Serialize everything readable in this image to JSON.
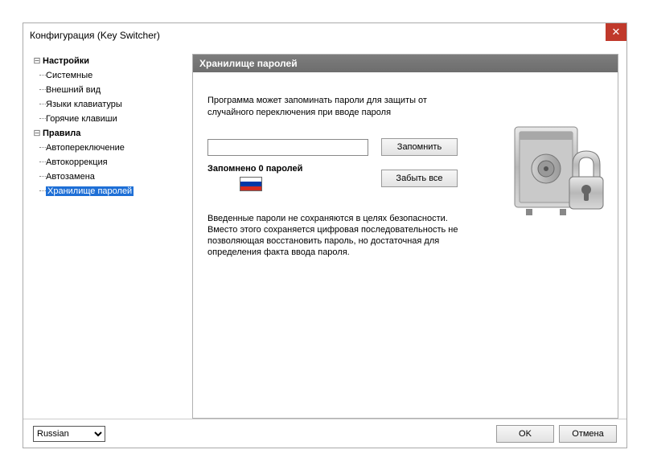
{
  "window": {
    "title": "Конфигурация (Key Switcher)"
  },
  "tree": {
    "group1": "Настройки",
    "g1_items": [
      "Системные",
      "Внешний вид",
      "Языки клавиатуры",
      "Горячие клавиши"
    ],
    "group2": "Правила",
    "g2_items": [
      "Автопереключение",
      "Автокоррекция",
      "Автозамена",
      "Хранилище паролей"
    ]
  },
  "panel": {
    "header": "Хранилище паролей",
    "desc1": "Программа может запоминать пароли для защиты от случайного переключения при вводе пароля",
    "remember_btn": "Запомнить",
    "forget_btn": "Забыть все",
    "remembered": "Запомнено 0 паролей",
    "desc2": "Введенные пароли не сохраняются в целях безопасности. Вместо этого сохраняется цифровая последовательность не позволяющая восстановить пароль, но достаточная для определения факта ввода пароля."
  },
  "footer": {
    "language": "Russian",
    "ok": "OK",
    "cancel": "Отмена"
  }
}
